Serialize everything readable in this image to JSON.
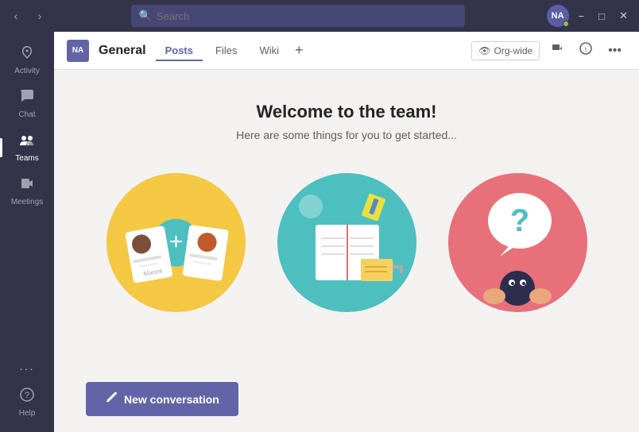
{
  "titlebar": {
    "search_placeholder": "Search",
    "avatar_initials": "NA",
    "minimize_label": "−",
    "maximize_label": "□",
    "close_label": "✕"
  },
  "sidebar": {
    "items": [
      {
        "id": "activity",
        "label": "Activity",
        "icon": "🔔"
      },
      {
        "id": "chat",
        "label": "Chat",
        "icon": "💬"
      },
      {
        "id": "teams",
        "label": "Teams",
        "icon": "👥"
      },
      {
        "id": "meetings",
        "label": "Meetings",
        "icon": "📅"
      }
    ],
    "more_label": "...",
    "help_label": "Help"
  },
  "channel": {
    "avatar_text": "NA",
    "name": "General",
    "tabs": [
      {
        "id": "posts",
        "label": "Posts",
        "active": true
      },
      {
        "id": "files",
        "label": "Files",
        "active": false
      },
      {
        "id": "wiki",
        "label": "Wiki",
        "active": false
      }
    ],
    "add_tab_label": "+",
    "org_wide_label": "Org-wide"
  },
  "content": {
    "welcome_title": "Welcome to the team!",
    "welcome_subtitle": "Here are some things for you to get started...",
    "new_conversation_label": "New conversation"
  }
}
